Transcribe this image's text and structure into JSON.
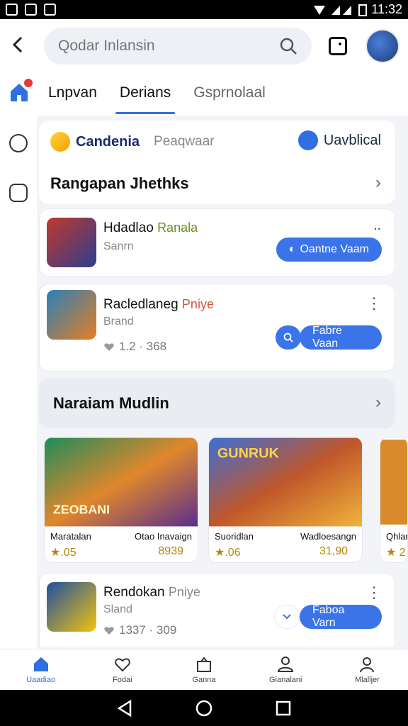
{
  "status_bar": {
    "time": "11:32"
  },
  "search": {
    "placeholder": "Qodar Inlansin"
  },
  "tabs": [
    {
      "label": "Lnpvan"
    },
    {
      "label": "Derians"
    },
    {
      "label": "Gsprnolaal"
    }
  ],
  "panel": {
    "brand": "Candenia",
    "sub": "Peaqwaar",
    "right_label": "Uavblical",
    "section_title": "Rangapan Jhethks"
  },
  "items": [
    {
      "title": "Hdadlao",
      "tag": "Ranala",
      "sub": "Sanrn",
      "button": "Oantne Vaam"
    },
    {
      "title": "Racledlaneg",
      "tag": "Pniye",
      "sub": "Brand",
      "rating": "1.2 · 368",
      "button": "Fabre Vaan"
    },
    {
      "title": "Rendokan",
      "tag": "Pniye",
      "sub": "Sland",
      "rating": "1337 · 309",
      "button": "Faboa Varn"
    }
  ],
  "section2": {
    "title": "Naraiam Mudlin"
  },
  "games": [
    {
      "title": "ZEOBANI",
      "label_left": "Maratalan",
      "label_right": "Otao Inavaign",
      "value_left": "★.05",
      "value_right": "8939"
    },
    {
      "title": "GUNRUK",
      "label_left": "Suoridlan",
      "label_right": "Wadloesangn",
      "value_left": "★.06",
      "value_right": "31,90"
    },
    {
      "title": "",
      "label_left": "Qhlar",
      "label_right": "",
      "value_left": "★ 2",
      "value_right": ""
    }
  ],
  "bottom_nav": [
    {
      "label": "Uaadiao"
    },
    {
      "label": "Fodai"
    },
    {
      "label": "Ganna"
    },
    {
      "label": "Gianalani"
    },
    {
      "label": "Mlalljer"
    }
  ],
  "colors": {
    "accent": "#3a74e8",
    "gold": "#b8860b",
    "alert": "#e53935"
  }
}
